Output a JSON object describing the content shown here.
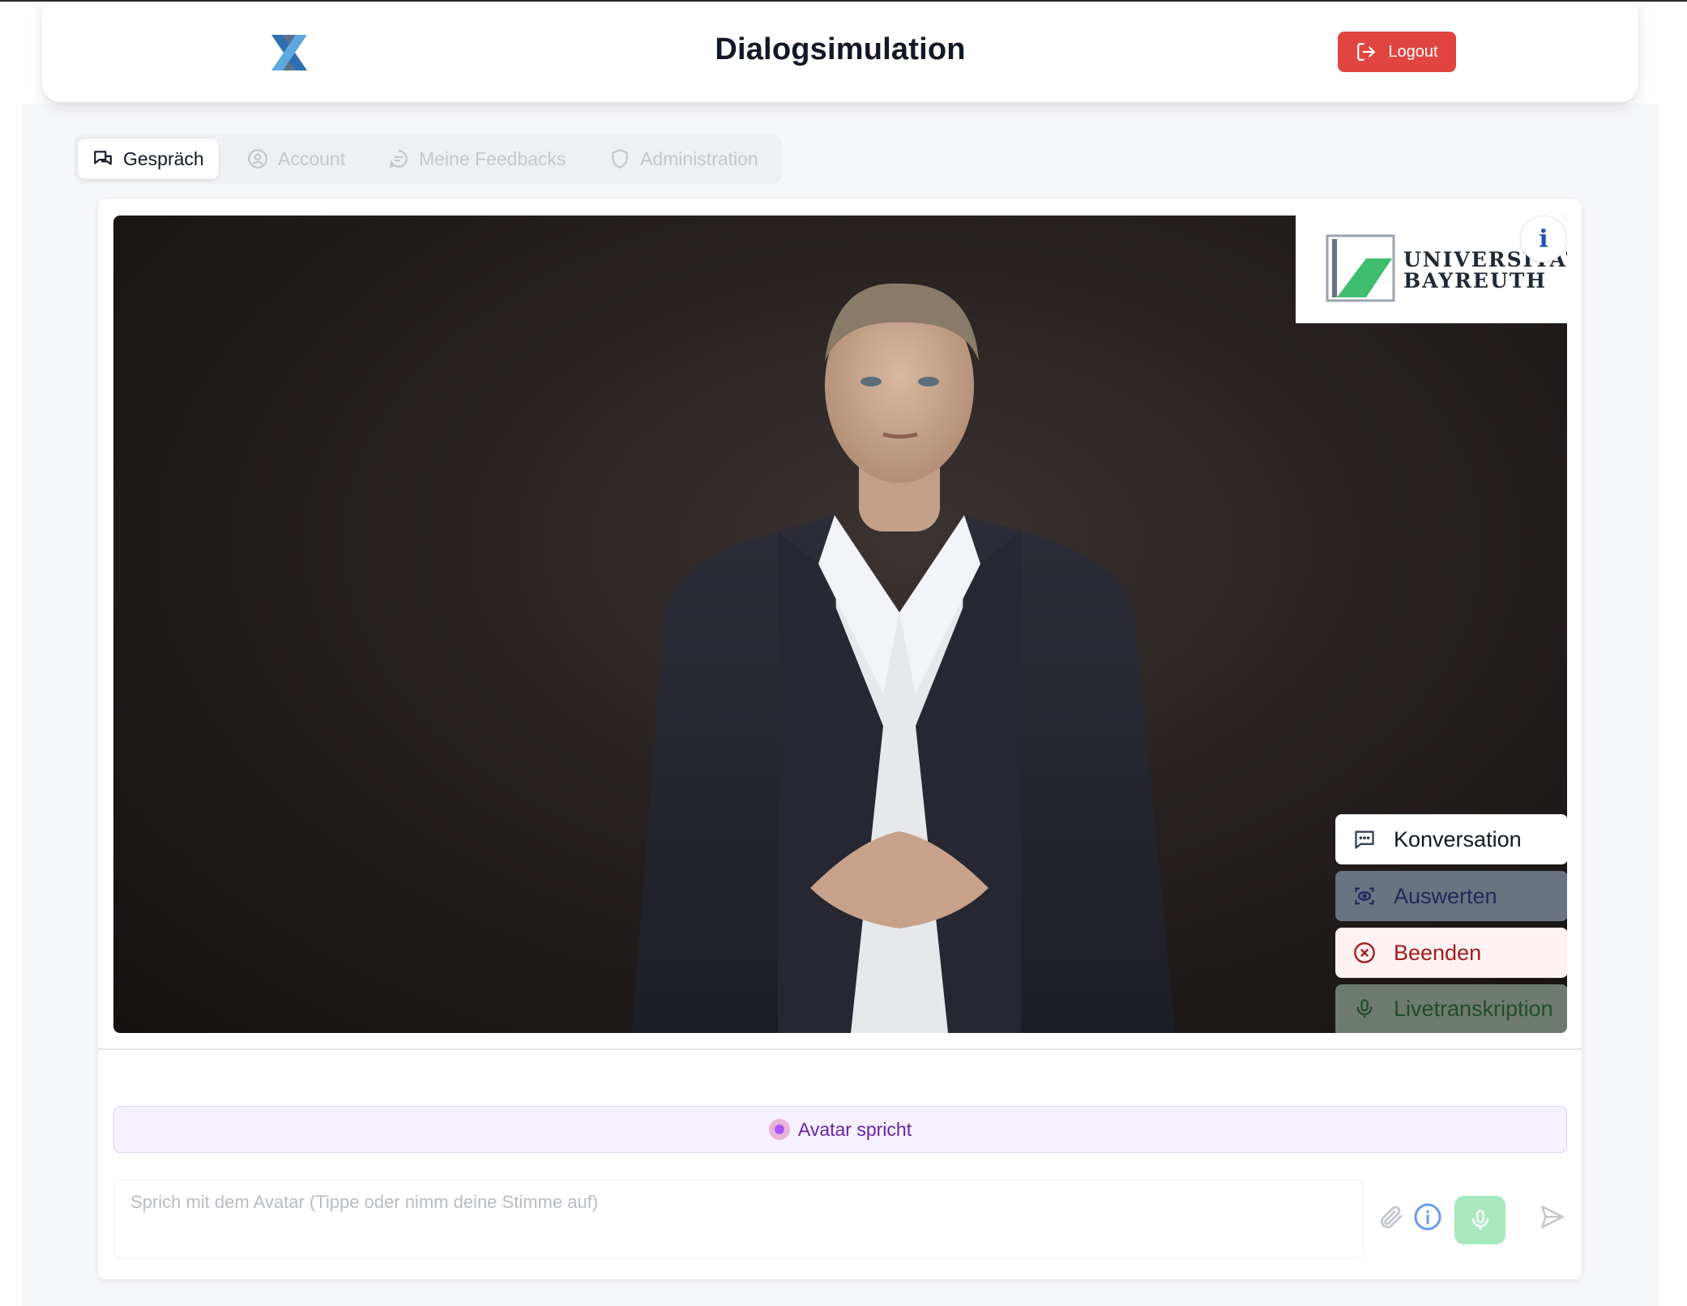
{
  "header": {
    "title": "Dialogsimulation",
    "logout_label": "Logout"
  },
  "tabs": [
    {
      "label": "Gespräch",
      "icon": "chat-bubbles-icon",
      "active": true
    },
    {
      "label": "Account",
      "icon": "user-circle-icon",
      "active": false
    },
    {
      "label": "Meine Feedbacks",
      "icon": "feedback-icon",
      "active": false
    },
    {
      "label": "Administration",
      "icon": "shield-icon",
      "active": false
    }
  ],
  "video": {
    "logo_line1": "UNIVERSITÄT",
    "logo_line2": "BAYREUTH",
    "info_glyph": "i"
  },
  "side_actions": [
    {
      "label": "Konversation",
      "icon": "message-square-icon"
    },
    {
      "label": "Auswerten",
      "icon": "scan-eye-icon"
    },
    {
      "label": "Beenden",
      "icon": "x-circle-icon"
    },
    {
      "label": "Livetranskription",
      "icon": "microphone-icon"
    }
  ],
  "status": {
    "text": "Avatar spricht"
  },
  "composer": {
    "value": "",
    "placeholder": "Sprich mit dem Avatar (Tippe oder nimm deine Stimme auf)"
  },
  "colors": {
    "logout": "#e0453f",
    "status_text": "#6b21a8",
    "status_bg": "#f5f1fe",
    "mic_button": "#a7e9bd",
    "stop_text": "#a11d1d"
  }
}
